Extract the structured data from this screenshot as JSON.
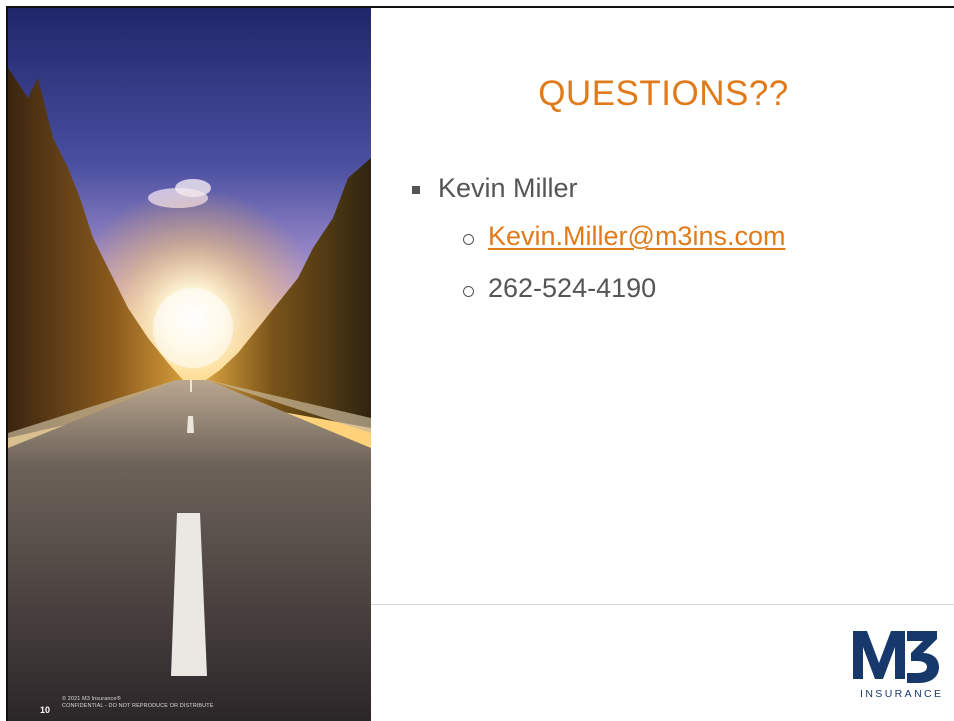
{
  "slide": {
    "title": "QUESTIONS??",
    "contact": {
      "name": "Kevin Miller",
      "email": "Kevin.Miller@m3ins.com",
      "phone": "262-524-4190"
    },
    "footer": {
      "page_number": "10",
      "copyright": "© 2021 M3 Insurance®",
      "notice": "CONFIDENTIAL - DO NOT REPRODUCE OR DISTRIBUTE"
    },
    "logo": {
      "mark": "M3",
      "wordmark": "INSURANCE"
    }
  },
  "colors": {
    "title": "#e07b1c",
    "body_text": "#555555",
    "link": "#e07b1c",
    "logo_navy": "#17386b"
  },
  "icons": [
    "square-bullet-icon",
    "circle-bullet-icon"
  ]
}
